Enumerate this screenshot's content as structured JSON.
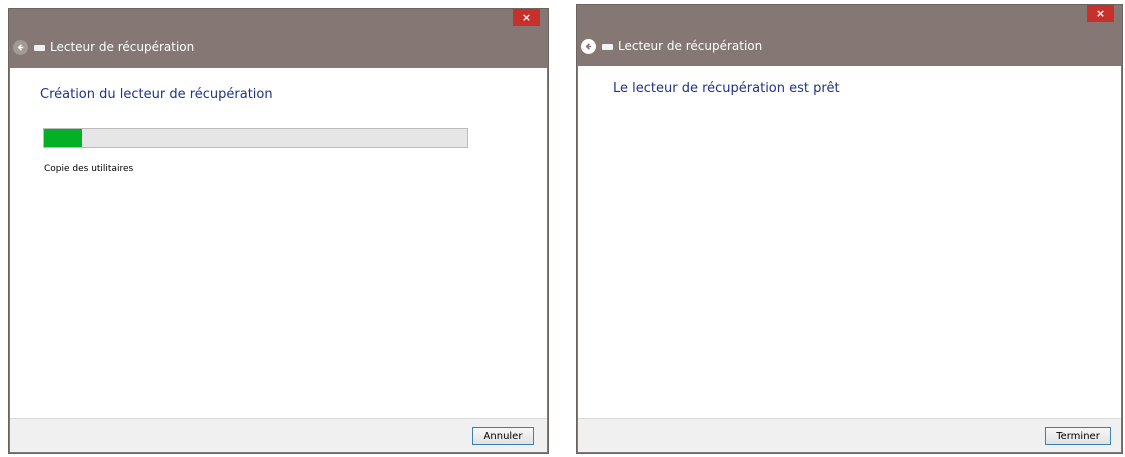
{
  "left_window": {
    "title": "Lecteur de récupération",
    "heading": "Création du lecteur de récupération",
    "progress_fraction": 0.09,
    "status": "Copie des utilitaires",
    "button": "Annuler",
    "close_glyph": "×"
  },
  "right_window": {
    "title": "Lecteur de récupération",
    "heading": "Le lecteur de récupération est prêt",
    "button": "Terminer",
    "close_glyph": "×"
  },
  "colors": {
    "titlebar": "#857874",
    "close": "#c7302b",
    "heading": "#1e3287",
    "progress": "#06b025"
  },
  "icons": [
    "back-arrow-icon",
    "drive-icon",
    "close-icon"
  ]
}
